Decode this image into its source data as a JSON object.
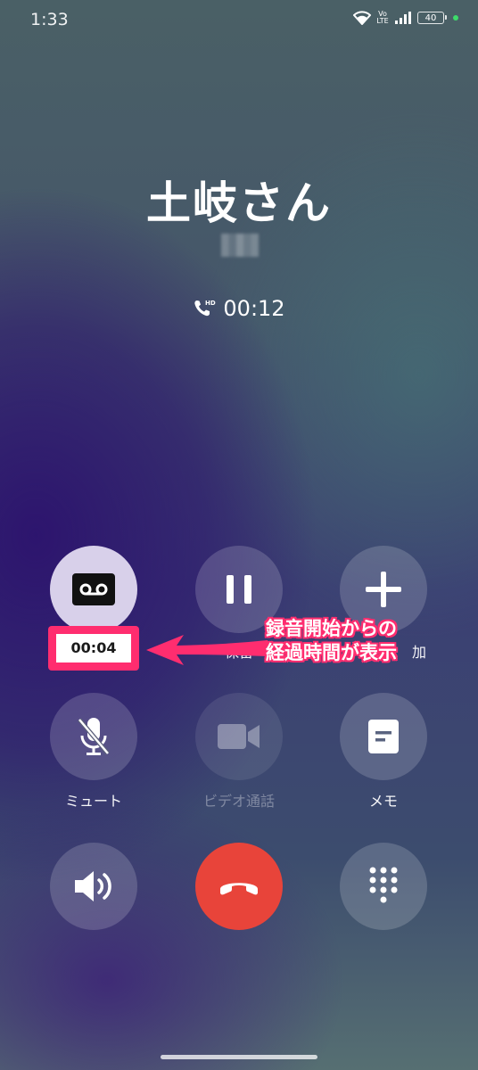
{
  "status_bar": {
    "time": "1:33",
    "volte_top": "Vo",
    "volte_bottom": "LTE",
    "battery": "40"
  },
  "caller": {
    "name": "土岐さん",
    "call_timer": "00:12",
    "hd_badge": "HD"
  },
  "controls": {
    "record_timer": "00:04",
    "hold_label": "保留",
    "add_label": "加",
    "mute_label": "ミュート",
    "video_label": "ビデオ通話",
    "memo_label": "メモ"
  },
  "annotation": {
    "line1": "録音開始からの",
    "line2": "経過時間が表示",
    "color": "#ff2d6f"
  },
  "colors": {
    "end_call": "#e8443a",
    "record_active": "#e1daf0"
  }
}
